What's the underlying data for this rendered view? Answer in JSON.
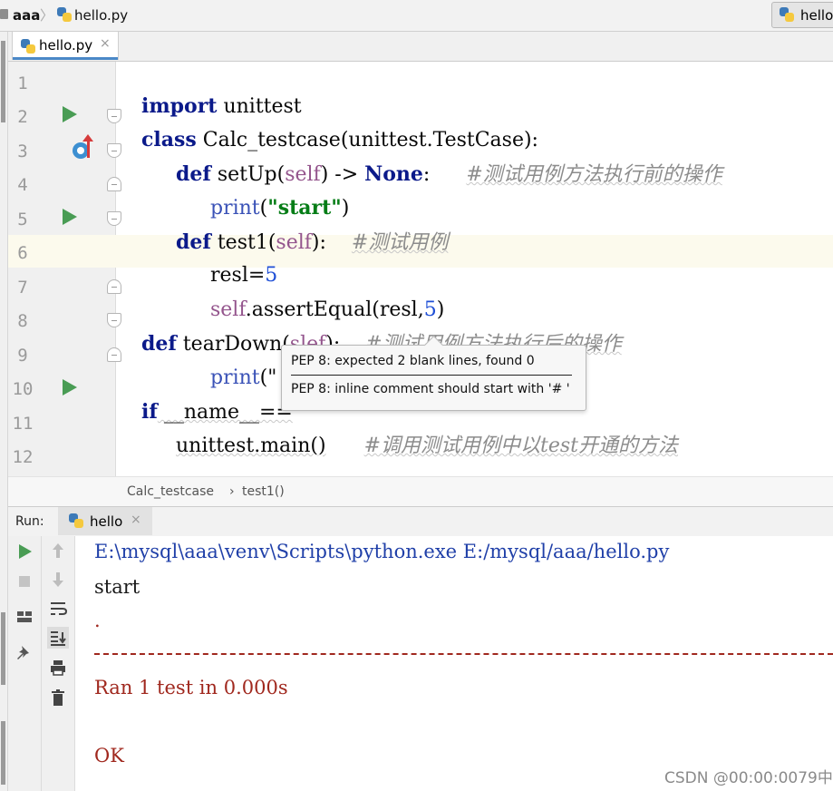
{
  "navbar": {
    "project": "aaa",
    "separator": "〉",
    "file": "hello.py",
    "run_config": "hello"
  },
  "editor_tab": {
    "label": "hello.py",
    "close": "×"
  },
  "line_numbers": [
    "1",
    "2",
    "3",
    "4",
    "5",
    "6",
    "7",
    "8",
    "9",
    "10",
    "11",
    "12"
  ],
  "code": {
    "l1": {
      "kw": "import",
      "rest": " unittest"
    },
    "l2": {
      "kw": "class",
      "name": " Calc_testcase(unittest.TestCase):"
    },
    "l3": {
      "kw": "def",
      "name": " setUp(",
      "self": "self",
      "mid": ") -> ",
      "none": "None",
      "colon": ":",
      "comment": "#测试用例方法执行前的操作"
    },
    "l4": {
      "fn": "print",
      "open": "(",
      "str": "\"start\"",
      "close": ")"
    },
    "l5": {
      "kw": "def",
      "name": " test1(",
      "self": "self",
      "colon": "):",
      "comment": "#测试用例"
    },
    "l6": {
      "var": "resl=",
      "num": "5"
    },
    "l7": {
      "self": "self",
      "call": ".assertEqual(resl,",
      "num": "5",
      "close": ")"
    },
    "l8": {
      "kw": "def",
      "name": " tearDown(",
      "self": "slef",
      "colon": "):",
      "comment": "#测试用例方法执行后的操作"
    },
    "l9": {
      "fn": "print",
      "open": "(\""
    },
    "l10": {
      "kw": "if",
      "rest": " __name__=="
    },
    "l11": {
      "call": "unittest.main()",
      "comment": "#调用测试用例中以test开通的方法"
    }
  },
  "tooltip": {
    "line1": "PEP 8: expected 2 blank lines, found 0",
    "line2": "PEP 8: inline comment should start with '# '"
  },
  "code_breadcrumb": {
    "item1": "Calc_testcase",
    "sep": "›",
    "item2": "test1()"
  },
  "run_panel": {
    "label": "Run:",
    "tab": "hello",
    "close": "×",
    "output": {
      "cmd": "E:\\mysql\\aaa\\venv\\Scripts\\python.exe E:/mysql/aaa/hello.py",
      "start": "start",
      "dot": ".",
      "ran": "Ran 1 test in 0.000s",
      "ok": "OK"
    }
  },
  "watermark": "CSDN @00:00:0079中",
  "colors": {
    "run_green": "#499c54",
    "keyword": "#0b1a8a",
    "self": "#94558d",
    "error_red": "#a0281e",
    "line_highlight": "#fcfaed"
  },
  "icons": [
    "folder-icon",
    "python-file-icon",
    "run-gutter-icon",
    "fold-icon",
    "breakpoint-icon",
    "override-arrow-icon",
    "rerun-icon",
    "stop-icon",
    "layout-icon",
    "pin-icon",
    "up-arrow-icon",
    "down-arrow-icon",
    "soft-wrap-icon",
    "scroll-to-end-icon",
    "print-icon",
    "trash-icon"
  ]
}
